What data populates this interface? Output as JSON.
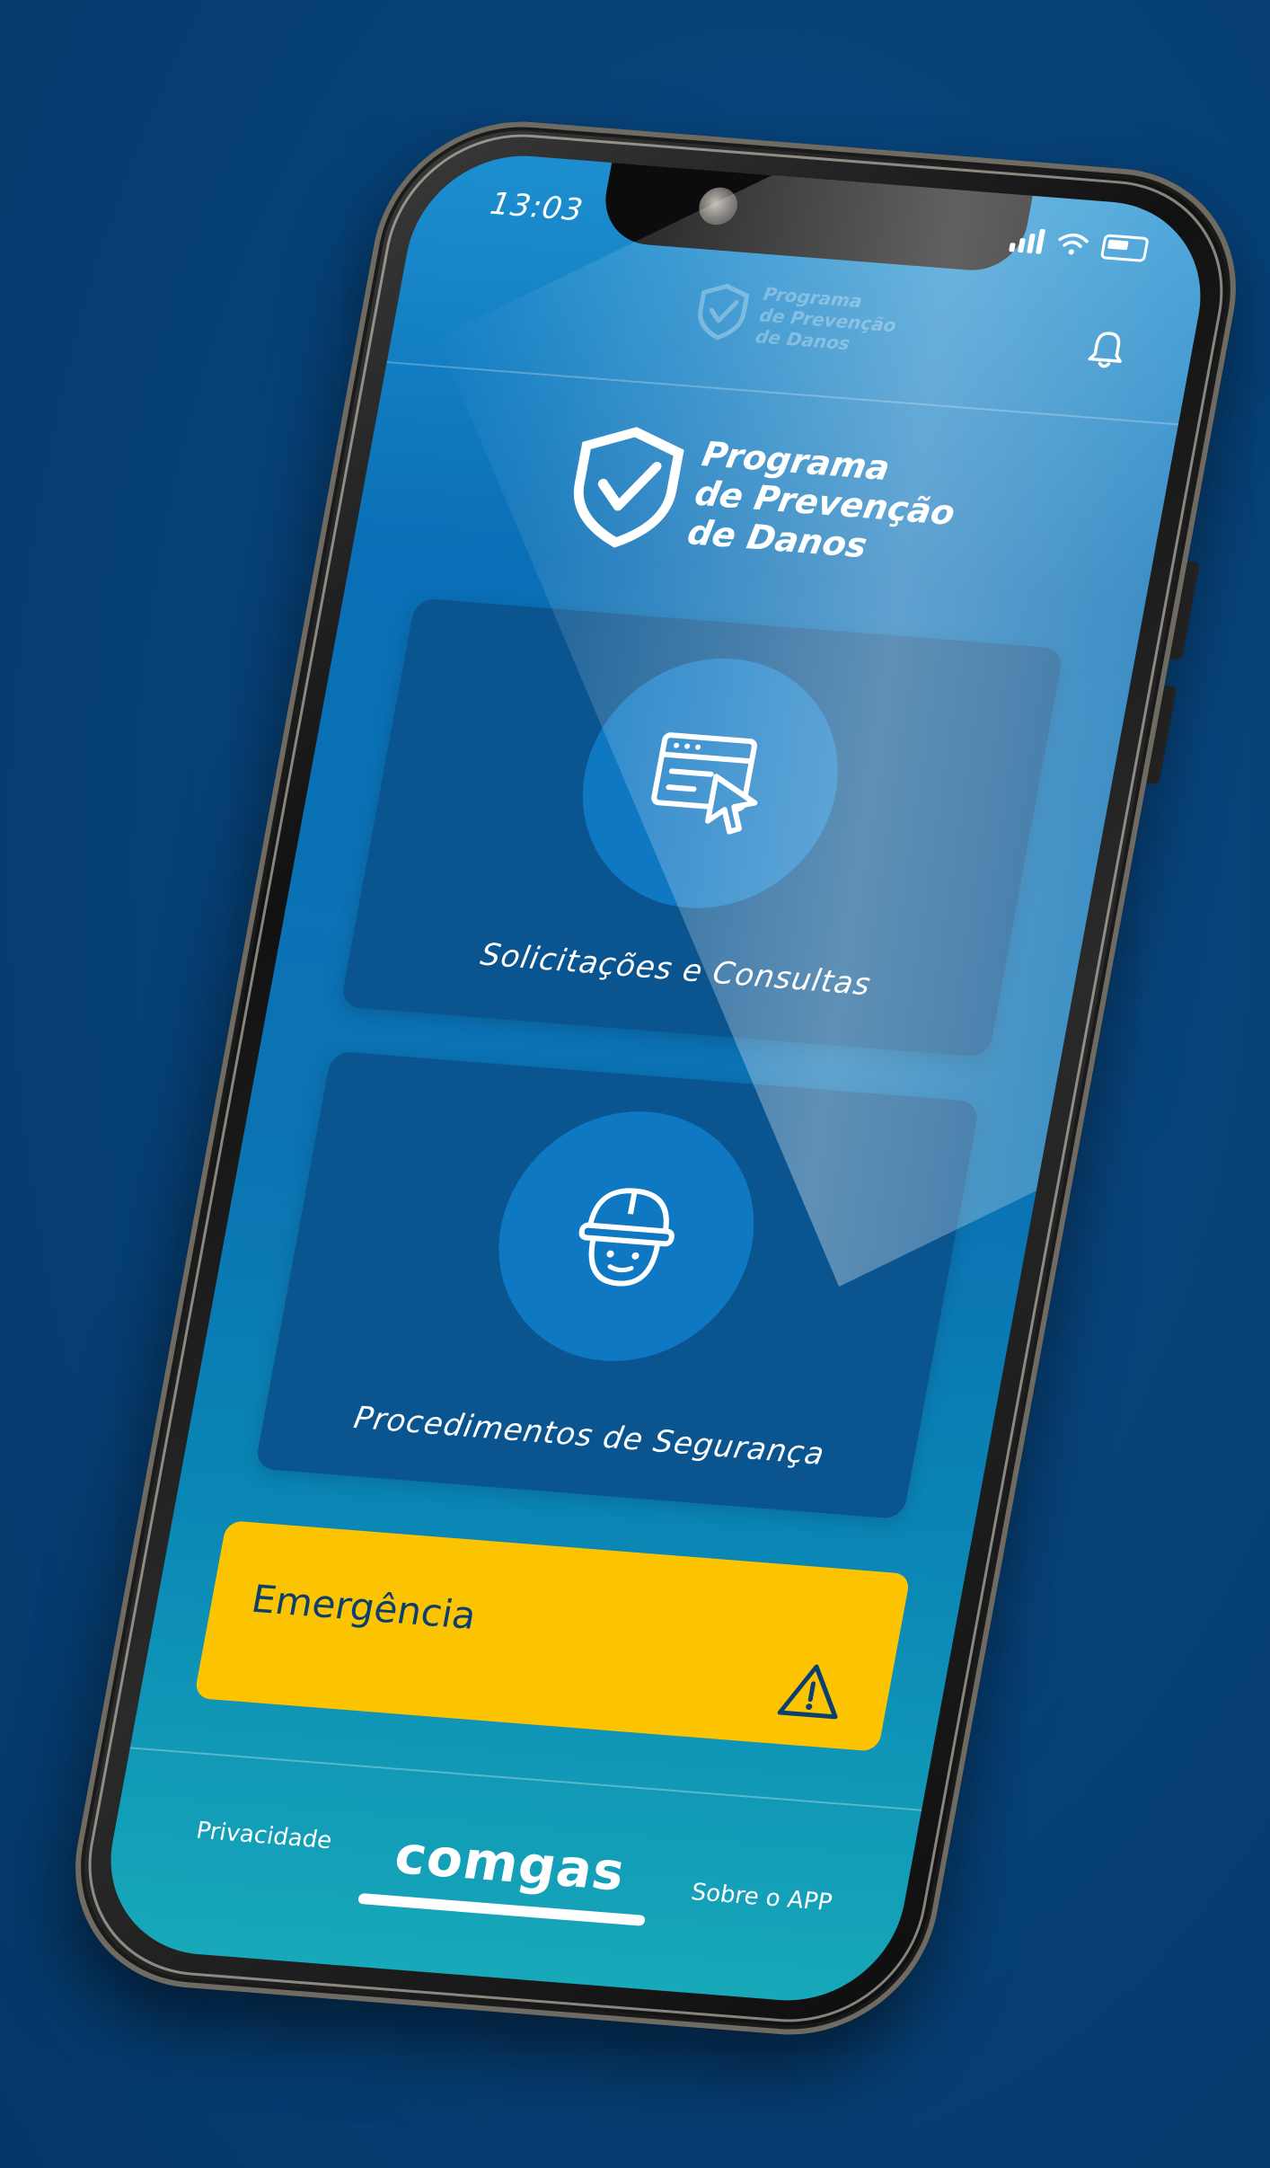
{
  "status_bar": {
    "time": "13:03"
  },
  "header": {
    "logo_lines": [
      "Programa",
      "de Prevenção",
      "de Danos"
    ],
    "icons": {
      "shield": "shield-check-icon",
      "bell": "bell-icon"
    }
  },
  "hero": {
    "logo_lines": [
      "Programa",
      "de Prevenção",
      "de Danos"
    ]
  },
  "cards": [
    {
      "label": "Solicitações e Consultas",
      "icon": "browser-cursor-icon"
    },
    {
      "label": "Procedimentos de Segurança",
      "icon": "worker-helmet-icon"
    }
  ],
  "emergency": {
    "label": "Emergência",
    "icon": "warning-triangle-icon"
  },
  "footer": {
    "privacy": "Privacidade",
    "brand": "comgas",
    "about": "Sobre o APP"
  },
  "colors": {
    "background": "#063f73",
    "card": "#0a5590",
    "card_circle": "#0f78c3",
    "emergency": "#fcc400",
    "emergency_text": "#0b3f6e"
  }
}
